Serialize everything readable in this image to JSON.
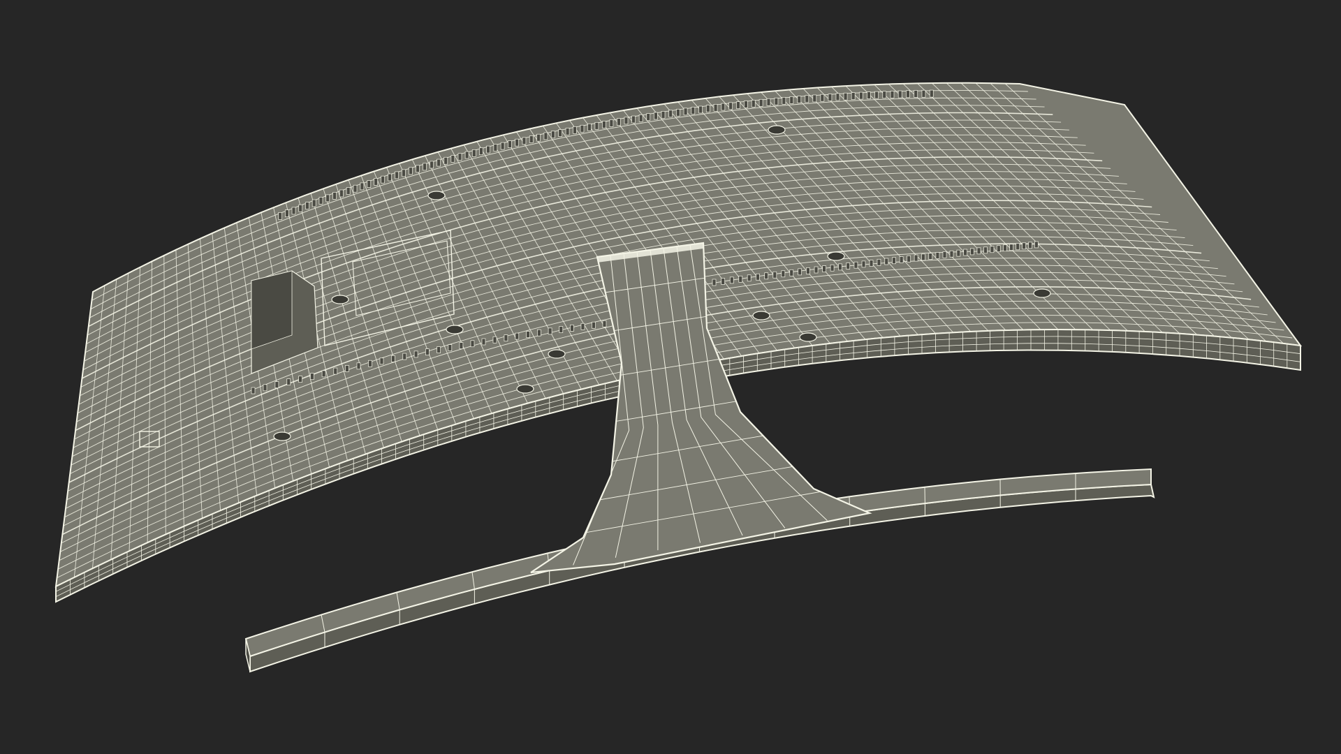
{
  "scene": {
    "subject": "curved-monitor-wireframe",
    "render_style": "wireframe",
    "colors": {
      "background": "#262626",
      "surface": "#7a7a70",
      "surface_dark": "#5e5e55",
      "surface_shadow": "#4a4a43",
      "wire": "#f4f4e6",
      "wire_dim": "#d8d8c8",
      "hole": "#3a3a34"
    }
  }
}
